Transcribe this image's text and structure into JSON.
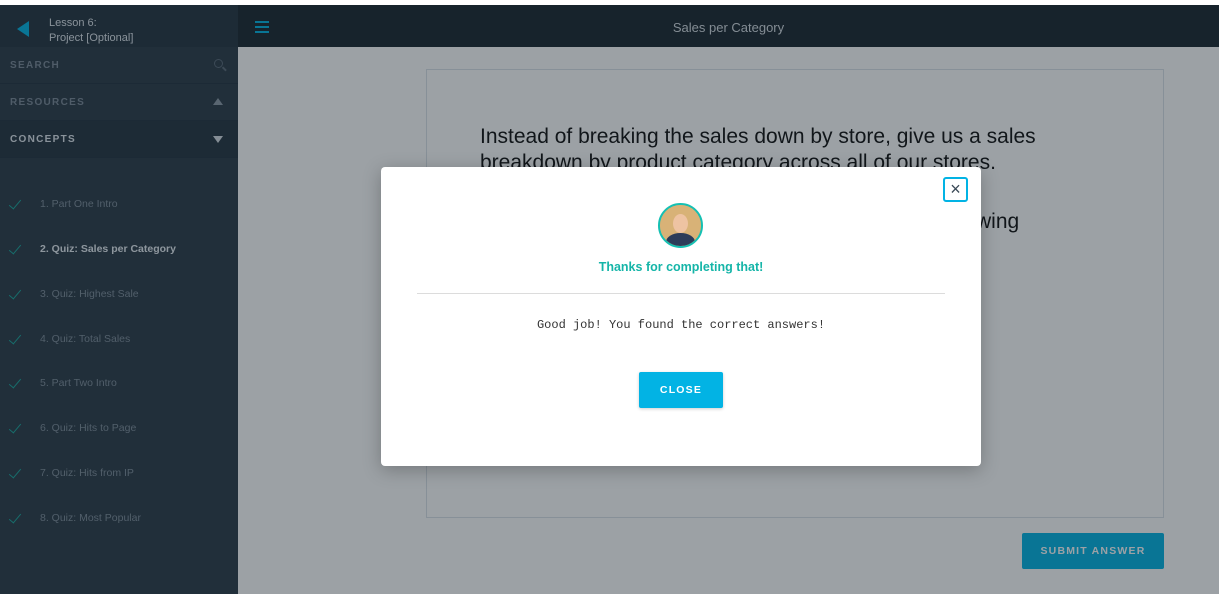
{
  "sidebar": {
    "lesson_line1": "Lesson 6:",
    "lesson_line2": "Project [Optional]",
    "search_label": "SEARCH",
    "resources_label": "RESOURCES",
    "concepts_label": "CONCEPTS",
    "concepts": [
      {
        "label": "1. Part One Intro",
        "done": true
      },
      {
        "label": "2. Quiz: Sales per Category",
        "done": true,
        "current": true
      },
      {
        "label": "3. Quiz: Highest Sale",
        "done": true
      },
      {
        "label": "4. Quiz: Total Sales",
        "done": true
      },
      {
        "label": "5. Part Two Intro",
        "done": true
      },
      {
        "label": "6. Quiz: Hits to Page",
        "done": true
      },
      {
        "label": "7. Quiz: Hits from IP",
        "done": true
      },
      {
        "label": "8. Quiz: Most Popular",
        "done": true
      }
    ]
  },
  "header": {
    "title": "Sales per Category"
  },
  "quiz": {
    "prompt": "Instead of breaking the sales down by store, give us a sales breakdown by product category across all of our stores.",
    "prompt_partial": "wing",
    "submit_label": "SUBMIT ANSWER"
  },
  "modal": {
    "close_glyph": "×",
    "heading": "Thanks for completing that!",
    "message": "Good job! You found the correct answers!",
    "button_label": "CLOSE"
  },
  "colors": {
    "accent": "#02b3e4",
    "success": "#15b5a8",
    "sidebar_bg": "#2c3b48",
    "topbar_bg": "#1b2630"
  },
  "icons": [
    "back-arrow-icon",
    "search-icon",
    "chevron-up-icon",
    "chevron-down-icon",
    "check-icon",
    "hamburger-menu-icon",
    "close-icon"
  ]
}
